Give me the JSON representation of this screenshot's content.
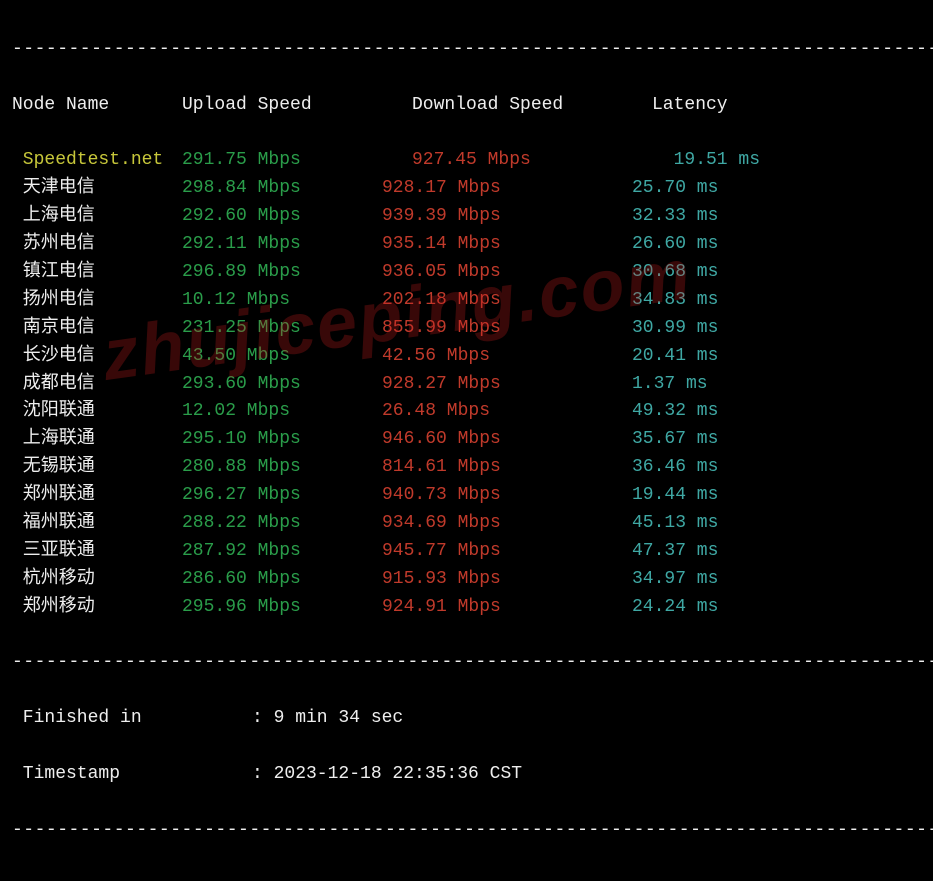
{
  "dashes": "----------------------------------------------------------------------------------",
  "header": {
    "name": "Node Name",
    "upload": "Upload Speed",
    "download": "Download Speed",
    "latency": "Latency"
  },
  "rows": [
    {
      "name": "Speedtest.net",
      "upload": "291.75 Mbps",
      "download": "927.45 Mbps",
      "latency": "19.51 ms",
      "name_color": "yellow",
      "latency_indent": true
    },
    {
      "name": "天津电信",
      "upload": "298.84 Mbps",
      "download": "928.17 Mbps",
      "latency": "25.70 ms"
    },
    {
      "name": "上海电信",
      "upload": "292.60 Mbps",
      "download": "939.39 Mbps",
      "latency": "32.33 ms"
    },
    {
      "name": "苏州电信",
      "upload": "292.11 Mbps",
      "download": "935.14 Mbps",
      "latency": "26.60 ms"
    },
    {
      "name": "镇江电信",
      "upload": "296.89 Mbps",
      "download": "936.05 Mbps",
      "latency": "30.68 ms"
    },
    {
      "name": "扬州电信",
      "upload": "10.12 Mbps",
      "download": "202.18 Mbps",
      "latency": "34.83 ms"
    },
    {
      "name": "南京电信",
      "upload": "231.25 Mbps",
      "download": "855.99 Mbps",
      "latency": "30.99 ms"
    },
    {
      "name": "长沙电信",
      "upload": "43.50 Mbps",
      "download": "42.56 Mbps",
      "latency": "20.41 ms"
    },
    {
      "name": "成都电信",
      "upload": "293.60 Mbps",
      "download": "928.27 Mbps",
      "latency": "1.37 ms"
    },
    {
      "name": "沈阳联通",
      "upload": "12.02 Mbps",
      "download": "26.48 Mbps",
      "latency": "49.32 ms"
    },
    {
      "name": "上海联通",
      "upload": "295.10 Mbps",
      "download": "946.60 Mbps",
      "latency": "35.67 ms"
    },
    {
      "name": "无锡联通",
      "upload": "280.88 Mbps",
      "download": "814.61 Mbps",
      "latency": "36.46 ms"
    },
    {
      "name": "郑州联通",
      "upload": "296.27 Mbps",
      "download": "940.73 Mbps",
      "latency": "19.44 ms"
    },
    {
      "name": "福州联通",
      "upload": "288.22 Mbps",
      "download": "934.69 Mbps",
      "latency": "45.13 ms"
    },
    {
      "name": "三亚联通",
      "upload": "287.92 Mbps",
      "download": "945.77 Mbps",
      "latency": "47.37 ms"
    },
    {
      "name": "杭州移动",
      "upload": "286.60 Mbps",
      "download": "915.93 Mbps",
      "latency": "34.97 ms"
    },
    {
      "name": "郑州移动",
      "upload": "295.96 Mbps",
      "download": "924.91 Mbps",
      "latency": "24.24 ms"
    }
  ],
  "footer": {
    "finished_label": "Finished in",
    "finished_value": "9 min 34 sec",
    "timestamp_label": "Timestamp",
    "timestamp_value": "2023-12-18 22:35:36 CST"
  },
  "watermark": "zhujiceping.com"
}
